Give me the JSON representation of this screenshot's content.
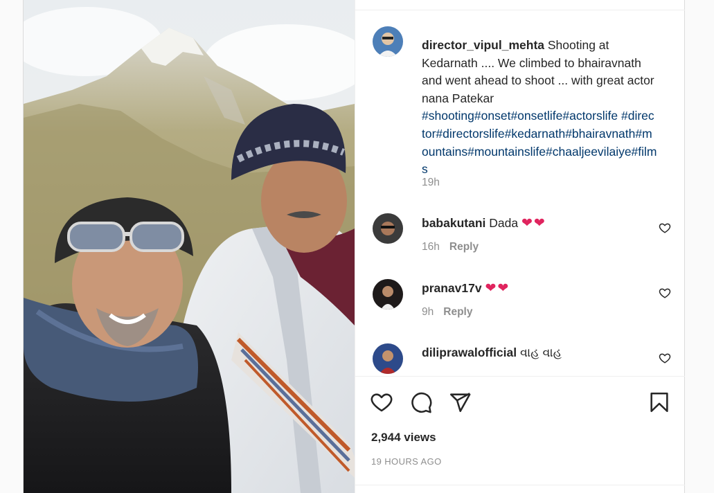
{
  "post": {
    "photo_alt": "",
    "author": "director_vipul_mehta",
    "caption_text": " Shooting at Kedarnath .... We climbed to bhairavnath and went ahead to shoot ... with great actor nana Patekar",
    "caption_tags": "#shooting#onset#onsetlife#actorslife #director#directorslife#kedarnath#bhairavnath#mountains#mountainslife#chaaljeevilaiye#films",
    "caption_time": "19h"
  },
  "comments": [
    {
      "user": "babakutani",
      "text": "Dada ",
      "emoji": "❤❤",
      "time": "16h",
      "reply": "Reply"
    },
    {
      "user": "pranav17v",
      "text": "",
      "emoji": "❤❤",
      "time": "9h",
      "reply": "Reply"
    },
    {
      "user": "diliprawalofficial",
      "text": " વાહ વાહ",
      "emoji": "",
      "time": "",
      "reply": ""
    }
  ],
  "stats": {
    "views": "2,944 views",
    "posted_ago": "19 HOURS AGO"
  },
  "icons": [
    "heart-icon",
    "comment-icon",
    "share-icon",
    "bookmark-icon"
  ],
  "colors": {
    "link": "#00376b",
    "muted": "#8e8e8e",
    "heart": "#e0245e"
  }
}
